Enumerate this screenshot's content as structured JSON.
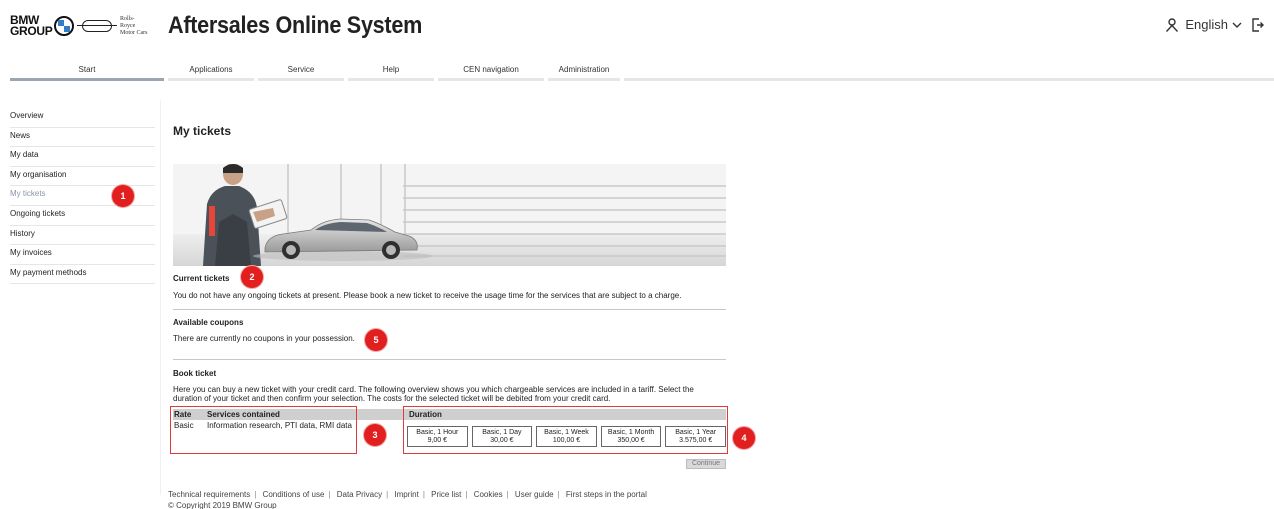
{
  "header": {
    "brand": {
      "group_text": "BMW GROUP",
      "rr_text": "Rolls-Royce"
    },
    "app_title": "Aftersales Online System",
    "language": "English",
    "icons": [
      "user-icon",
      "chevron-down-icon",
      "logout-icon"
    ]
  },
  "topnav": {
    "tabs": [
      {
        "label": "Start",
        "active": true
      },
      {
        "label": "Applications"
      },
      {
        "label": "Service"
      },
      {
        "label": "Help"
      },
      {
        "label": "CEN navigation"
      },
      {
        "label": "Administration"
      }
    ]
  },
  "sidebar": {
    "items": [
      {
        "label": "Overview"
      },
      {
        "label": "News"
      },
      {
        "label": "My data"
      },
      {
        "label": "My organisation"
      },
      {
        "label": "My tickets",
        "active": true
      },
      {
        "label": "Ongoing tickets"
      },
      {
        "label": "History"
      },
      {
        "label": "My invoices"
      },
      {
        "label": "My payment methods"
      }
    ]
  },
  "main": {
    "title": "My tickets",
    "current_tickets": {
      "title": "Current tickets",
      "text": "You do not have any ongoing tickets at present. Please book a new ticket to receive the usage time for the services that are subject to a charge."
    },
    "coupons": {
      "title": "Available coupons",
      "text": "There are currently no coupons in your possession."
    },
    "book_ticket": {
      "title": "Book ticket",
      "text_line1": "Here you can buy a new ticket with your credit card. The following overview shows you which chargeable services are included in a tariff. Select the",
      "text_line2": "duration of your ticket and then confirm your selection. The costs for the selected ticket will be debited from your credit card.",
      "rate_table": {
        "headers": {
          "rate": "Rate",
          "services": "Services contained"
        },
        "rows": [
          {
            "rate": "Basic",
            "services": "Information research, PTI data, RMI data"
          }
        ]
      },
      "duration_table": {
        "header": "Duration",
        "options": [
          {
            "label": "Basic, 1 Hour",
            "price": "9,00 €"
          },
          {
            "label": "Basic, 1 Day",
            "price": "30,00 €"
          },
          {
            "label": "Basic, 1 Week",
            "price": "100,00 €"
          },
          {
            "label": "Basic, 1 Month",
            "price": "350,00 €"
          },
          {
            "label": "Basic, 1 Year",
            "price": "3.575,00 €"
          }
        ]
      },
      "continue_label": "Continue"
    }
  },
  "footer": {
    "links": [
      "Technical requirements",
      "Conditions of use",
      "Data Privacy",
      "Imprint",
      "Price list",
      "Cookies",
      "User guide",
      "First steps in the portal"
    ],
    "copyright": "© Copyright 2019 BMW Group"
  },
  "annotations": {
    "markers": [
      "1",
      "2",
      "3",
      "4",
      "5"
    ],
    "color": "#e11f1f"
  }
}
